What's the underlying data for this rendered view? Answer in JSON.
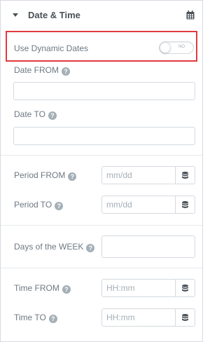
{
  "section": {
    "title": "Date & Time",
    "icon": "calendar-icon",
    "caret_icon": "caret-down-icon"
  },
  "dynamic_dates": {
    "label": "Use Dynamic Dates",
    "toggle_text": "NO",
    "enabled": false,
    "highlight_color": "#e2393f"
  },
  "date_from": {
    "label": "Date FROM",
    "value": "",
    "placeholder": ""
  },
  "date_to": {
    "label": "Date TO",
    "value": "",
    "placeholder": ""
  },
  "period_from": {
    "label": "Period FROM",
    "placeholder": "mm/dd",
    "button_icon": "database-icon"
  },
  "period_to": {
    "label": "Period TO",
    "placeholder": "mm/dd",
    "button_icon": "database-icon"
  },
  "days_of_week": {
    "label": "Days of the WEEK",
    "value": ""
  },
  "time_from": {
    "label": "Time FROM",
    "placeholder": "HH:mm",
    "button_icon": "database-icon"
  },
  "time_to": {
    "label": "Time TO",
    "placeholder": "HH:mm",
    "button_icon": "database-icon"
  },
  "help_glyph": "?"
}
